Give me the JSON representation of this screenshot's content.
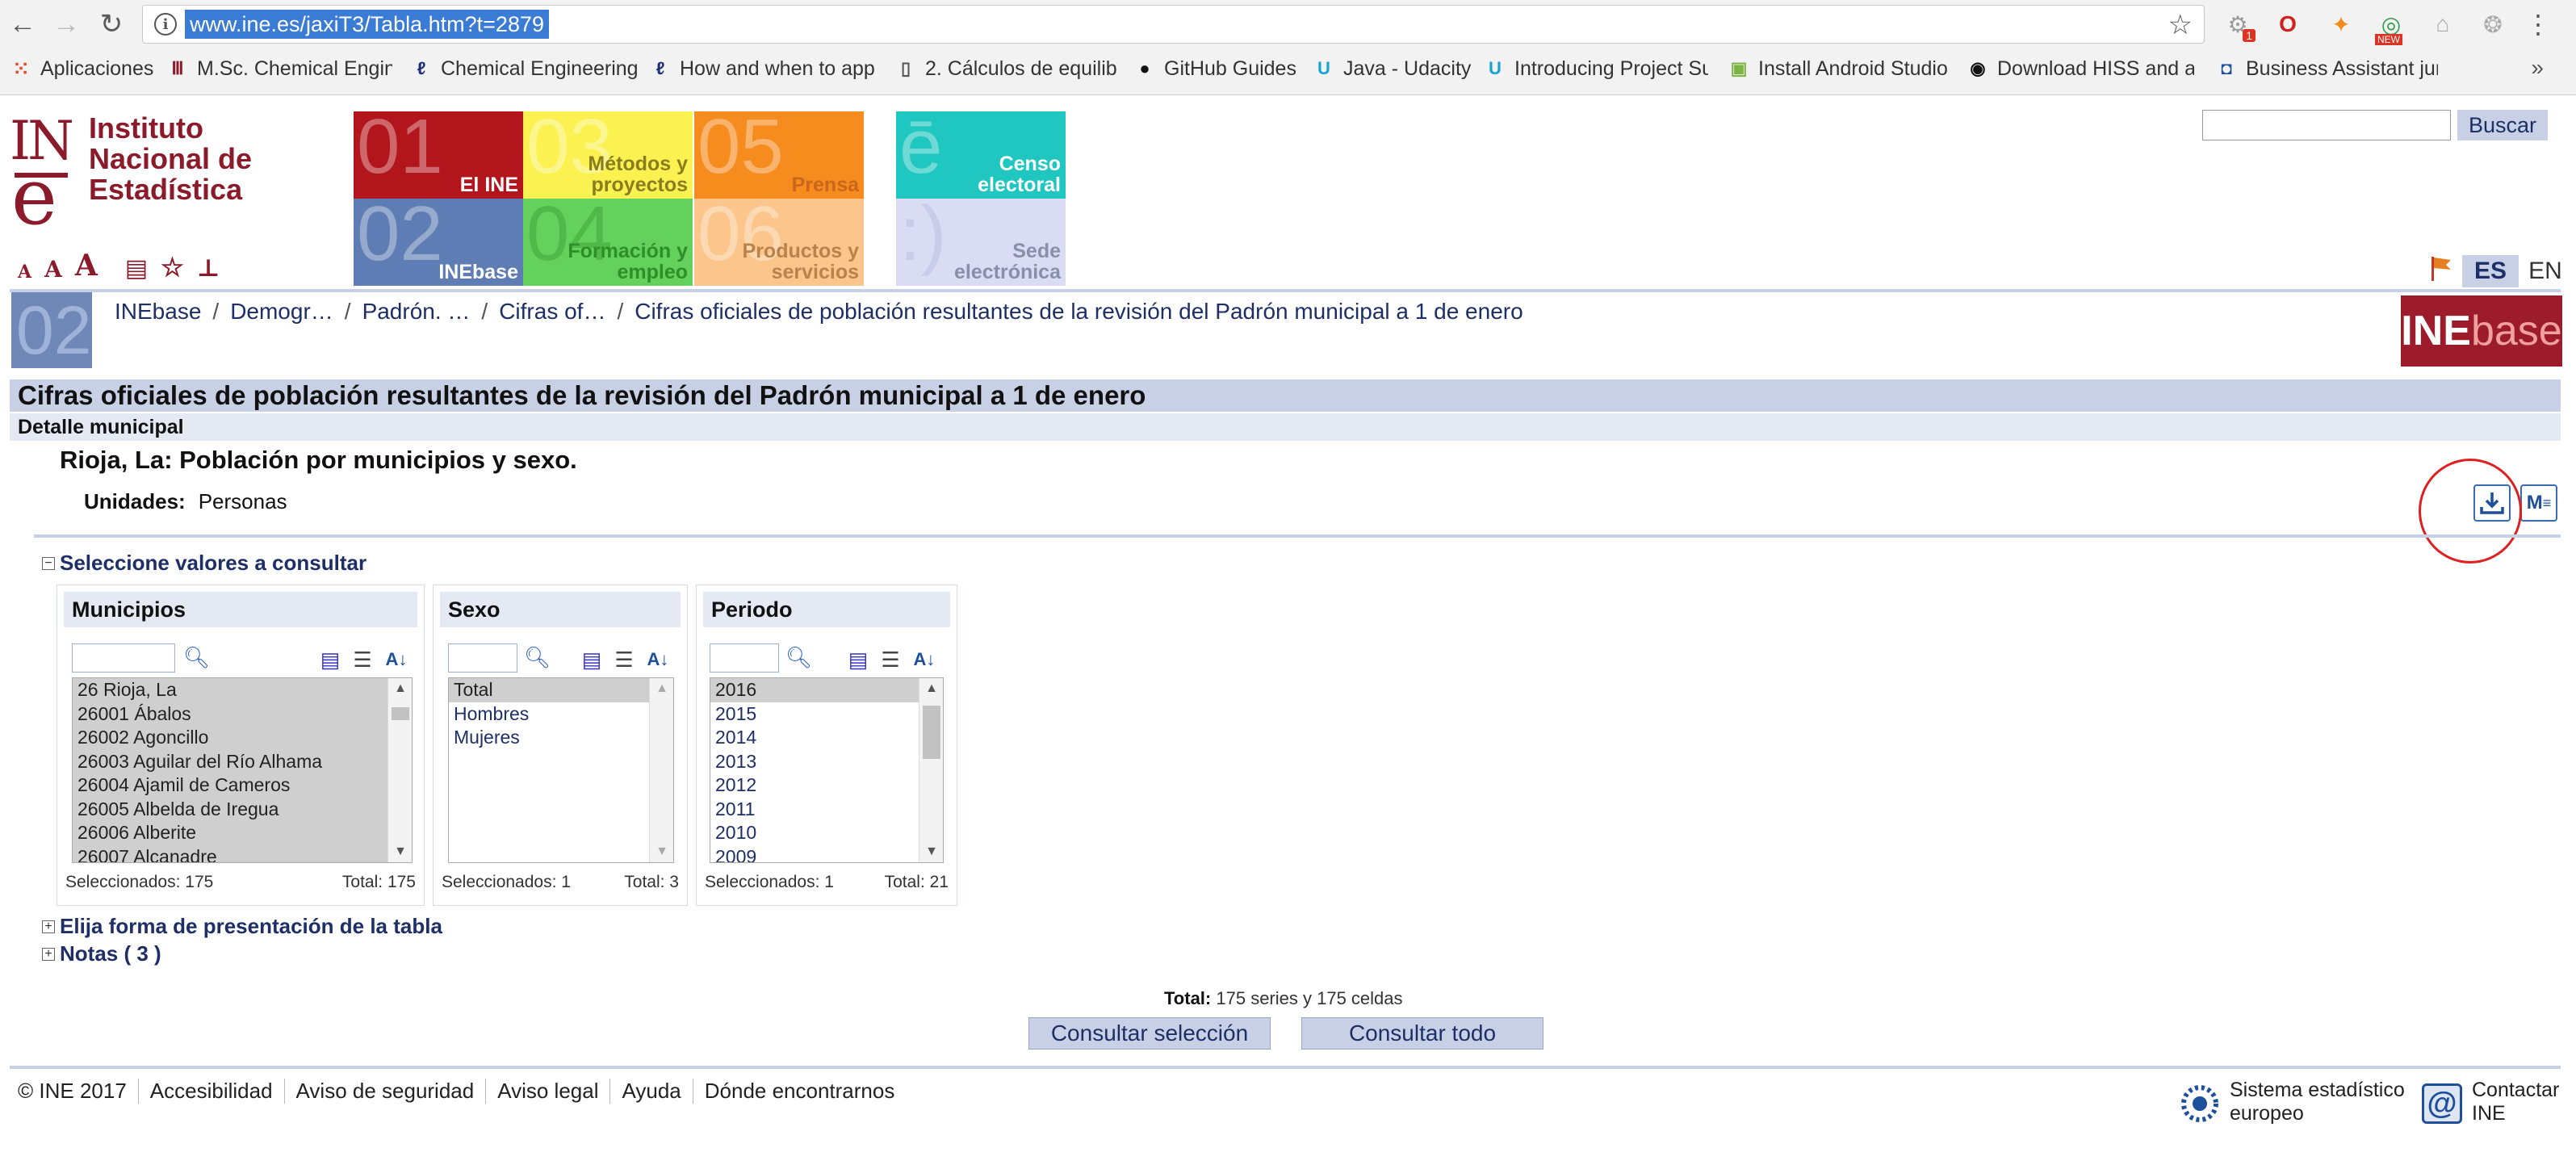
{
  "browser": {
    "url": "www.ine.es/jaxiT3/Tabla.htm?t=2879",
    "bookmarks": [
      "Aplicaciones",
      "M.Sc. Chemical Engine",
      "Chemical Engineering",
      "How and when to app",
      "2. Cálculos de equilibr",
      "GitHub Guides",
      "Java - Udacity",
      "Introducing Project Su",
      "Install Android Studio",
      "Download HISS and a",
      "Business Assistant jun"
    ],
    "bookmarks_more": "»",
    "extension_badges": {
      "red": "1",
      "new": "NEW"
    }
  },
  "header": {
    "logo_text": [
      "Instituto",
      "Nacional de",
      "Estadística"
    ],
    "logo_mark": {
      "in": "IN",
      "e": "e"
    },
    "tools": [
      "A",
      "A",
      "A"
    ],
    "tiles": [
      {
        "num": "01",
        "label": "El INE",
        "color": "#b2151b"
      },
      {
        "num": "03",
        "label": "Métodos y proyectos",
        "color": "#fbf252"
      },
      {
        "num": "05",
        "label": "Prensa",
        "color": "#f68b1e"
      },
      {
        "num": "ē",
        "label": "Censo electoral",
        "color": "#1fc7c0"
      },
      {
        "num": "02",
        "label": "INEbase",
        "color": "#5e7db4"
      },
      {
        "num": "04",
        "label": "Formación y empleo",
        "color": "#64d15c"
      },
      {
        "num": "06",
        "label": "Productos y servicios",
        "color": "#fbc58b"
      },
      {
        "num": ":)",
        "label": "Sede electrónica",
        "color": "#d9dcf2"
      }
    ],
    "search_button": "Buscar",
    "lang_es": "ES",
    "lang_en": "EN"
  },
  "breadcrumb": {
    "section_num": "02",
    "items": [
      "INEbase",
      "Demogr…",
      "Padrón. …",
      "Cifras of…",
      "Cifras oficiales de población resultantes de la revisión del Padrón municipal a 1 de enero"
    ],
    "inebase_logo": {
      "a": "INE",
      "b": "base"
    }
  },
  "content": {
    "page_title": "Cifras oficiales de población resultantes de la revisión del Padrón municipal a 1 de enero",
    "section_title": "Detalle municipal",
    "table_title": "Rioja, La: Población por municipios y sexo.",
    "units_label": "Unidades:",
    "units_value": "Personas",
    "px_button": "M",
    "select_toggle": "Seleccione valores a consultar",
    "presentation_toggle": "Elija forma de presentación de la tabla",
    "notes_toggle": "Notas ( 3 )"
  },
  "panels": {
    "municipios": {
      "title": "Municipios",
      "items": [
        "26 Rioja, La",
        "26001 Ábalos",
        "26002 Agoncillo",
        "26003 Aguilar del Río Alhama",
        "26004 Ajamil de Cameros",
        "26005 Albelda de Iregua",
        "26006 Alberite",
        "26007 Alcanadre"
      ],
      "selected_label": "Seleccionados: 175",
      "total_label": "Total: 175"
    },
    "sexo": {
      "title": "Sexo",
      "items": [
        "Total",
        "Hombres",
        "Mujeres"
      ],
      "selected_label": "Seleccionados: 1",
      "total_label": "Total: 3"
    },
    "periodo": {
      "title": "Periodo",
      "items": [
        "2016",
        "2015",
        "2014",
        "2013",
        "2012",
        "2011",
        "2010",
        "2009"
      ],
      "selected_label": "Seleccionados: 1",
      "total_label": "Total: 21"
    }
  },
  "summary": {
    "total_label": "Total:",
    "total_value": "175 series y 175 celdas",
    "consult_selection": "Consultar selección",
    "consult_all": "Consultar todo"
  },
  "footer": {
    "links": [
      "© INE 2017",
      "Accesibilidad",
      "Aviso de seguridad",
      "Aviso legal",
      "Ayuda",
      "Dónde encontrarnos"
    ],
    "ess_line1": "Sistema estadístico",
    "ess_line2": "europeo",
    "contact_line1": "Contactar",
    "contact_line2": "INE"
  }
}
